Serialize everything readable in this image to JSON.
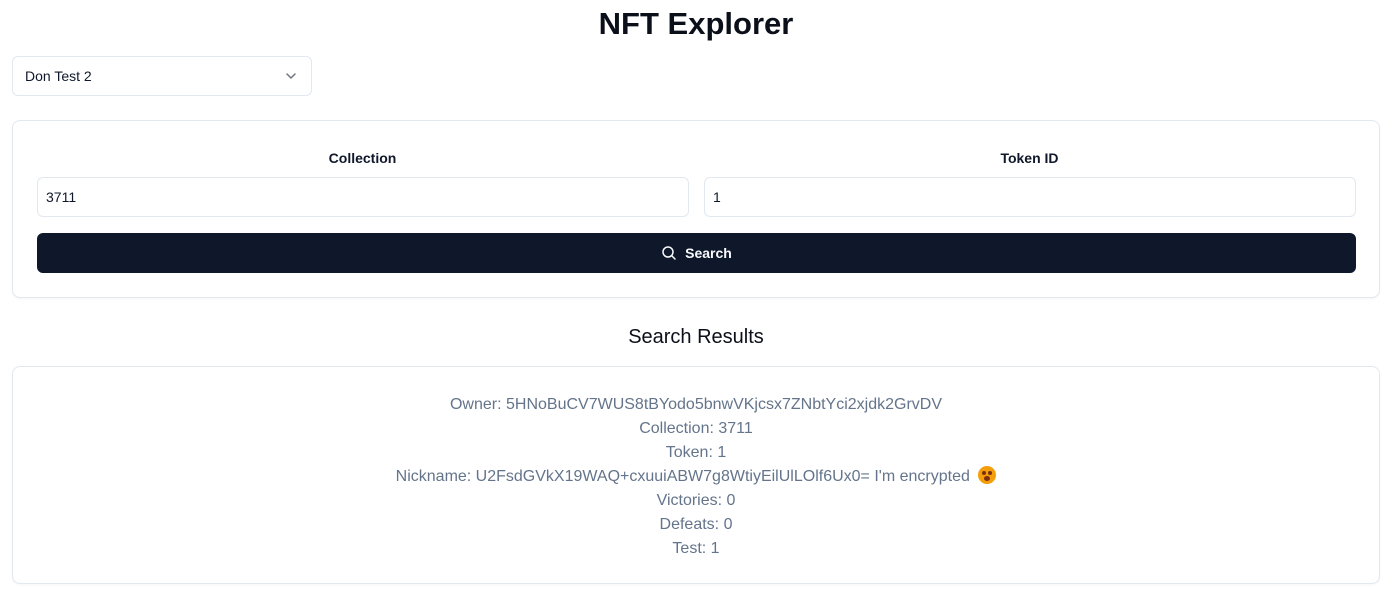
{
  "header": {
    "title": "NFT Explorer"
  },
  "network_select": {
    "selected": "Don Test 2",
    "icon": "chevron-down-icon"
  },
  "search_form": {
    "collection_label": "Collection",
    "collection_value": "3711",
    "token_label": "Token ID",
    "token_value": "1",
    "search_label": "Search",
    "search_icon": "search-icon"
  },
  "results": {
    "heading": "Search Results",
    "owner": "Owner: 5HNoBuCV7WUS8tBYodo5bnwVKjcsx7ZNbtYci2xjdk2GrvDV",
    "collection": "Collection: 3711",
    "token": "Token: 1",
    "nickname": "Nickname: U2FsdGVkX19WAQ+cxuuiABW7g8WtiyEilUlLOlf6Ux0= I'm encrypted",
    "nickname_emoji": "astonished-face-icon",
    "victories": "Victories: 0",
    "defeats": "Defeats: 0",
    "test": "Test: 1"
  }
}
